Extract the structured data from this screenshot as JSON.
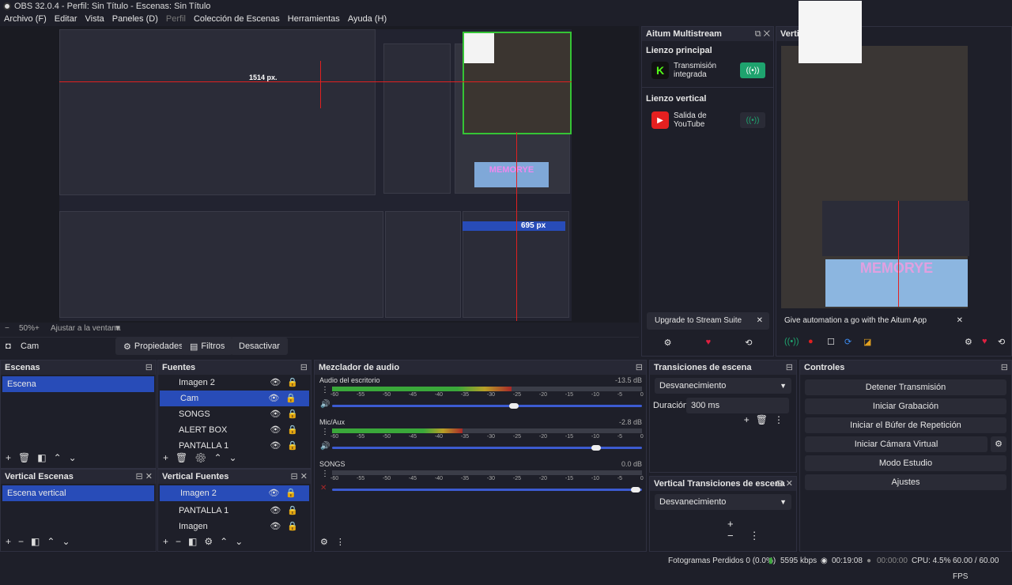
{
  "window": {
    "title": "OBS 32.0.4 - Perfil: Sin Título - Escenas: Sin Título"
  },
  "menu": {
    "items": [
      "Archivo (F)",
      "Editar",
      "Vista",
      "Paneles (D)",
      "Perfil",
      "Colección de Escenas",
      "Herramientas",
      "Ayuda (H)"
    ]
  },
  "preview": {
    "measure_label": "695 px",
    "inner_measure_label": "1514 px.",
    "zoom": "50%",
    "zoom_mode": "Ajustar a la ventana"
  },
  "source_bar": {
    "selected_source": "Cam",
    "properties": "Propiedades",
    "filters": "Filtros",
    "disable": "Desactivar"
  },
  "scenes": {
    "title": "Escenas",
    "items": [
      "Escena"
    ]
  },
  "sources": {
    "title": "Fuentes",
    "items": [
      "Imagen 2",
      "Cam",
      "SONGS",
      "ALERT BOX",
      "PANTALLA 1"
    ]
  },
  "vscenes": {
    "title": "Vertical Escenas",
    "items": [
      "Escena vertical"
    ]
  },
  "vsources": {
    "title": "Vertical Fuentes",
    "items": [
      "Imagen 2",
      "PANTALLA 1",
      "Imagen"
    ]
  },
  "mixer": {
    "title": "Mezclador de audio",
    "scale": [
      "-60",
      "-55",
      "-50",
      "-45",
      "-40",
      "-35",
      "-30",
      "-25",
      "-20",
      "-15",
      "-10",
      "-5",
      "0"
    ],
    "channels": [
      {
        "name": "Audio del escritorio",
        "db": "-13.5 dB",
        "level": 0.58,
        "volume": 0.58
      },
      {
        "name": "Mic/Aux",
        "db": "-2.8 dB",
        "level": 0.42,
        "volume": 0.85
      },
      {
        "name": "SONGS",
        "db": "0.0 dB",
        "level": 0.0,
        "volume": 0.98
      }
    ]
  },
  "transitions": {
    "title": "Transiciones de escena",
    "selected": "Desvanecimiento",
    "duration_label": "Duración",
    "duration": "300 ms"
  },
  "vtransitions": {
    "title": "Vertical Transiciones de escena",
    "selected": "Desvanecimiento"
  },
  "controls": {
    "title": "Controles",
    "buttons": [
      "Detener Transmisión",
      "Iniciar Grabación",
      "Iniciar el Búfer de Repetición",
      "Iniciar Cámara Virtual",
      "Modo Estudio",
      "Ajustes"
    ]
  },
  "aitum": {
    "title": "Aitum Multistream",
    "main_canvas": "Lienzo principal",
    "main_output": "Transmisión integrada",
    "vertical_canvas": "Lienzo vertical",
    "vertical_output": "Salida de YouTube",
    "upgrade": "Upgrade to Stream Suite",
    "automation": "Give automation a go with the Aitum App"
  },
  "vertical_dock": {
    "title": "Verti"
  },
  "overlay": {
    "banner": "MEMORYE"
  },
  "status": {
    "dropped": "Fotogramas Perdidos 0 (0.0%)",
    "bitrate": "5595 kbps",
    "stream_time": "00:19:08",
    "rec_time": "00:00:00",
    "cpu": "CPU: 4.5%",
    "fps": "60.00 / 60.00 FPS"
  },
  "colors": {
    "accent": "#284cb8",
    "kick": "#53fc18",
    "youtube": "#e52020",
    "live": "#1ea36e"
  }
}
